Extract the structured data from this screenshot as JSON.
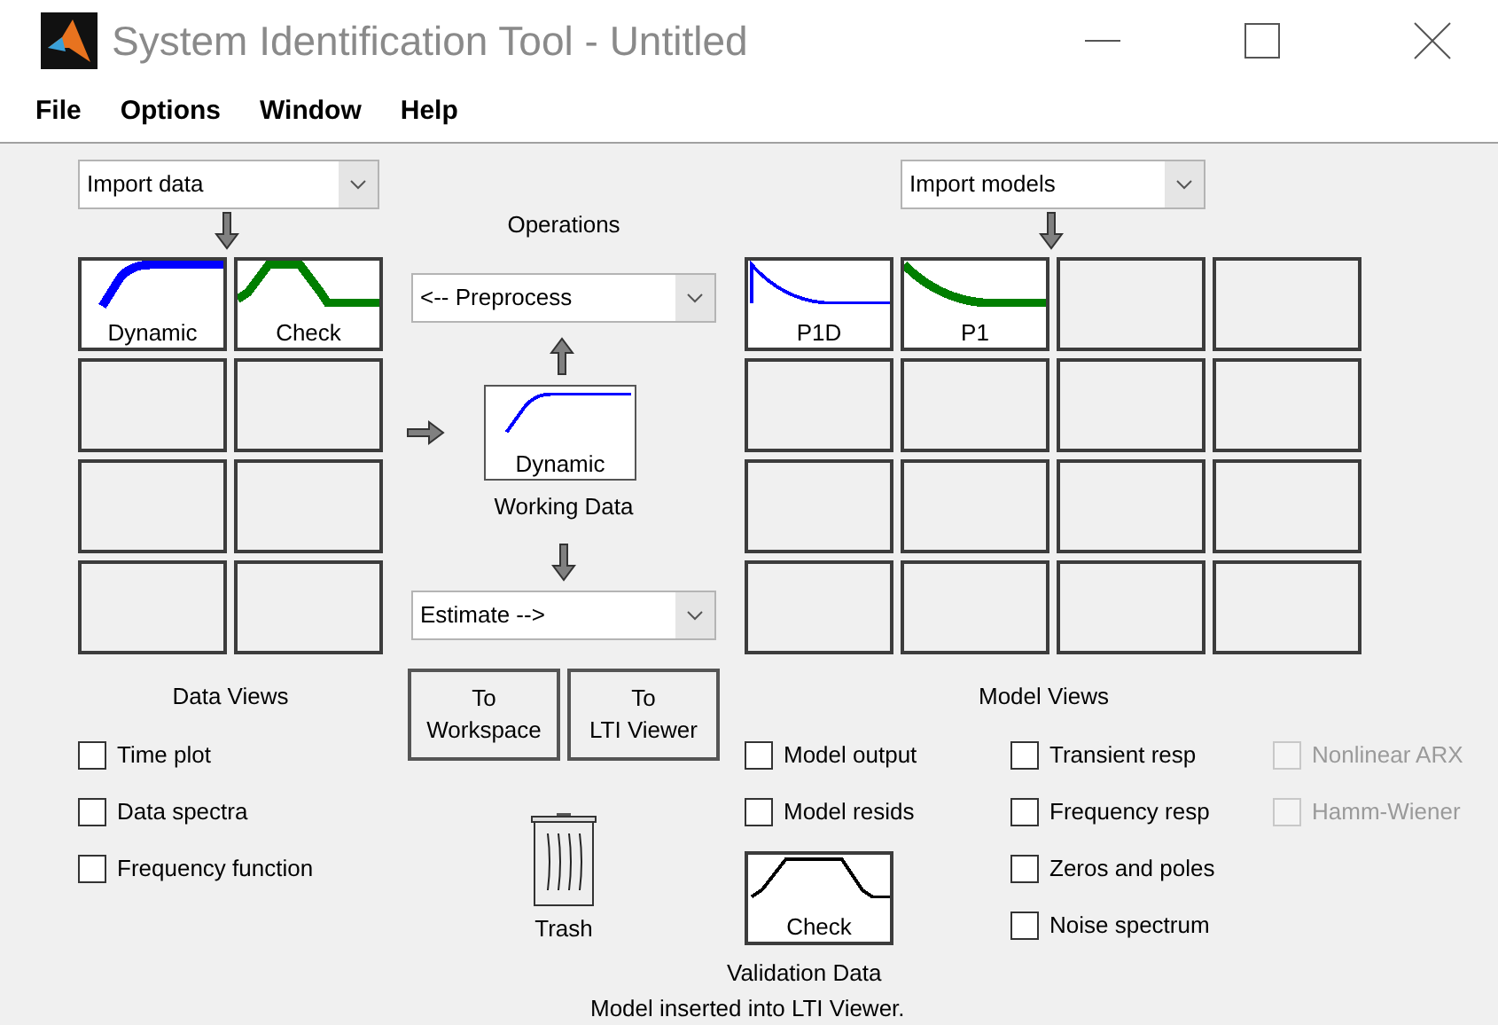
{
  "window": {
    "title": "System Identification Tool - Untitled"
  },
  "menu": [
    "File",
    "Options",
    "Window",
    "Help"
  ],
  "data_import": {
    "value": "Import data"
  },
  "data_board": [
    {
      "kind": "step",
      "label": "Dynamic",
      "color": "#0000ff"
    },
    {
      "kind": "pulse",
      "label": "Check",
      "color": "#007f00"
    },
    {
      "kind": "empty"
    },
    {
      "kind": "empty"
    },
    {
      "kind": "empty"
    },
    {
      "kind": "empty"
    },
    {
      "kind": "empty"
    },
    {
      "kind": "empty"
    }
  ],
  "operations": {
    "title": "Operations",
    "preprocess": "<-- Preprocess",
    "working_data": {
      "kind": "step_thin",
      "label": "Dynamic",
      "color": "#0000ff",
      "caption": "Working Data"
    },
    "estimate": "Estimate -->",
    "buttons": [
      {
        "lines": [
          "To",
          "Workspace"
        ]
      },
      {
        "lines": [
          "To",
          "LTI Viewer"
        ]
      }
    ]
  },
  "trash": {
    "label": "Trash"
  },
  "models_import": {
    "value": "Import models"
  },
  "model_board": [
    {
      "kind": "impulse",
      "label": "P1D",
      "color": "#0000ff"
    },
    {
      "kind": "decay",
      "label": "P1",
      "color": "#007f00"
    },
    {
      "kind": "empty"
    },
    {
      "kind": "empty"
    },
    {
      "kind": "empty"
    },
    {
      "kind": "empty"
    },
    {
      "kind": "empty"
    },
    {
      "kind": "empty"
    },
    {
      "kind": "empty"
    },
    {
      "kind": "empty"
    },
    {
      "kind": "empty"
    },
    {
      "kind": "empty"
    },
    {
      "kind": "empty"
    },
    {
      "kind": "empty"
    },
    {
      "kind": "empty"
    },
    {
      "kind": "empty"
    }
  ],
  "data_views": {
    "title": "Data Views",
    "options": [
      {
        "label": "Time plot",
        "checked": false
      },
      {
        "label": "Data spectra",
        "checked": false
      },
      {
        "label": "Frequency function",
        "checked": false
      }
    ]
  },
  "model_views": {
    "title": "Model Views",
    "columns": [
      [
        {
          "label": "Model output",
          "checked": false,
          "disabled": false
        },
        {
          "label": "Model resids",
          "checked": false,
          "disabled": false
        }
      ],
      [
        {
          "label": "Transient resp",
          "checked": false,
          "disabled": false
        },
        {
          "label": "Frequency resp",
          "checked": false,
          "disabled": false
        },
        {
          "label": "Zeros and poles",
          "checked": false,
          "disabled": false
        },
        {
          "label": "Noise spectrum",
          "checked": false,
          "disabled": false
        }
      ],
      [
        {
          "label": "Nonlinear ARX",
          "checked": false,
          "disabled": true
        },
        {
          "label": "Hamm-Wiener",
          "checked": false,
          "disabled": true
        }
      ]
    ]
  },
  "validation": {
    "kind": "pulse_thin",
    "label": "Check",
    "color": "#000000",
    "caption": "Validation Data"
  },
  "status": "Model inserted into LTI Viewer."
}
